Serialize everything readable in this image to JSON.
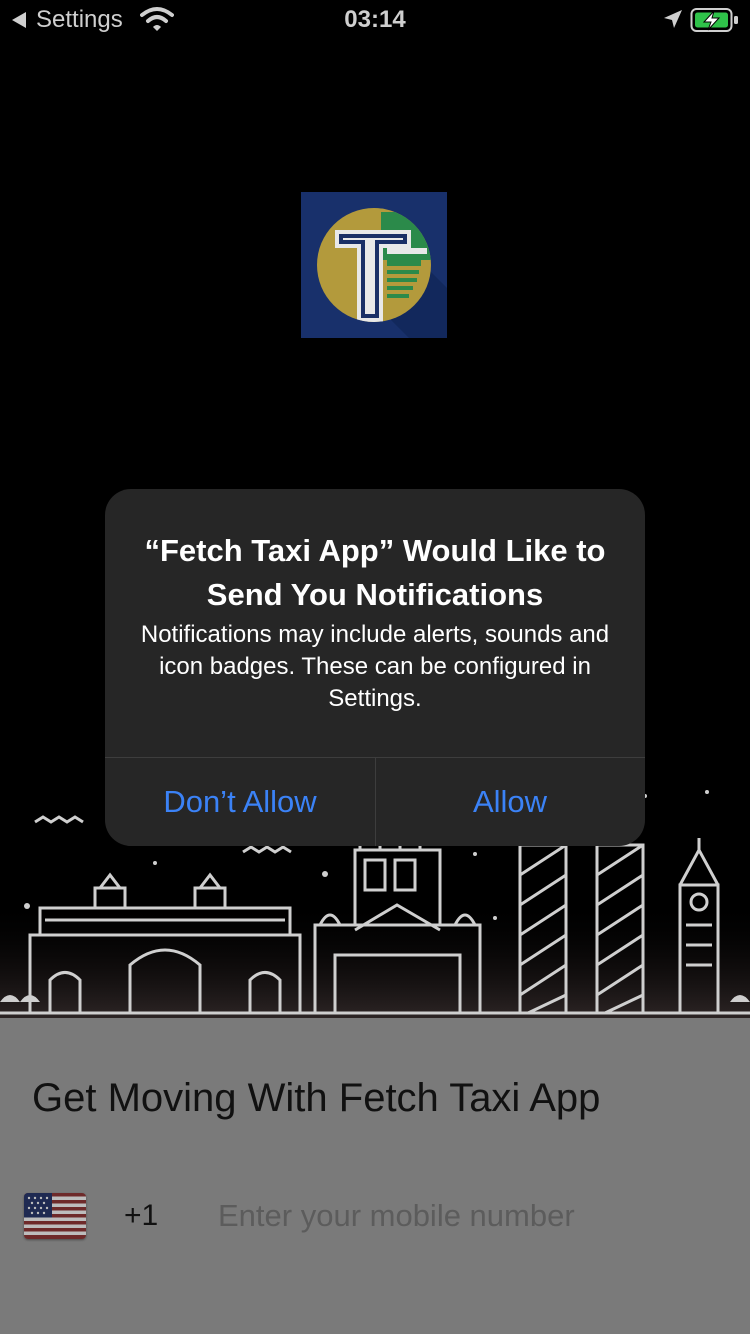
{
  "status_bar": {
    "back_label": "Settings",
    "time": "03:14",
    "icons": [
      "back-triangle-icon",
      "wifi-icon",
      "location-arrow-icon",
      "battery-charging-icon"
    ],
    "battery_color": "#2fc24a"
  },
  "app": {
    "logo_icon": "fetch-taxi-logo-icon",
    "accent": "#3b82f6"
  },
  "sheet": {
    "title": "Get Moving With Fetch Taxi App",
    "country_flag": "us-flag-icon",
    "dial_code": "+1",
    "phone_placeholder": "Enter your mobile number",
    "phone_value": ""
  },
  "alert": {
    "title": "“Fetch Taxi App” Would Like to Send You Notifications",
    "message": "Notifications may include alerts, sounds and icon badges. These can be configured in Settings.",
    "deny_label": "Don’t Allow",
    "allow_label": "Allow"
  }
}
